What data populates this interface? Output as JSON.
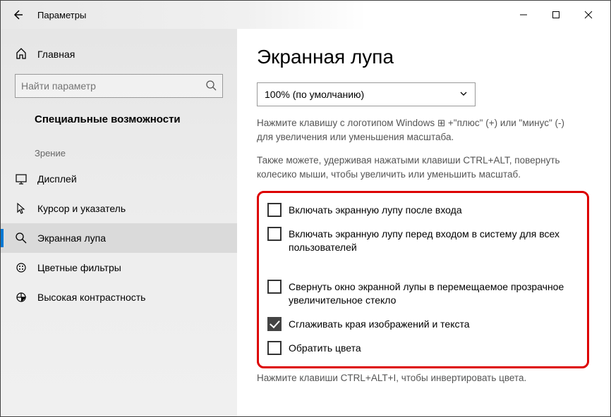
{
  "titlebar": {
    "title": "Параметры"
  },
  "sidebar": {
    "home": "Главная",
    "search_placeholder": "Найти параметр",
    "section": "Специальные возможности",
    "group": "Зрение",
    "items": [
      {
        "label": "Дисплей"
      },
      {
        "label": "Курсор и указатель"
      },
      {
        "label": "Экранная лупа"
      },
      {
        "label": "Цветные фильтры"
      },
      {
        "label": "Высокая контрастность"
      }
    ]
  },
  "main": {
    "title": "Экранная лупа",
    "zoom_select": "100% (по умолчанию)",
    "hint1": "Нажмите клавишу с логотипом Windows ⊞ +\"плюс\" (+) или \"минус\" (-) для увеличения или уменьшения масштаба.",
    "hint2": "Также можете, удерживая нажатыми клавиши CTRL+ALT, повернуть колесико мыши, чтобы увеличить или уменьшить масштаб.",
    "checkboxes": [
      {
        "label": "Включать экранную лупу после входа",
        "checked": false
      },
      {
        "label": "Включать экранную лупу перед входом в систему для всех пользователей",
        "checked": false
      },
      {
        "label": "Свернуть окно экранной лупы в перемещаемое прозрачное увеличительное стекло",
        "checked": false
      },
      {
        "label": "Сглаживать края изображений и текста",
        "checked": true
      },
      {
        "label": "Обратить цвета",
        "checked": false
      }
    ],
    "bottom_hint": "Нажмите клавиши CTRL+ALT+I, чтобы инвертировать цвета."
  }
}
